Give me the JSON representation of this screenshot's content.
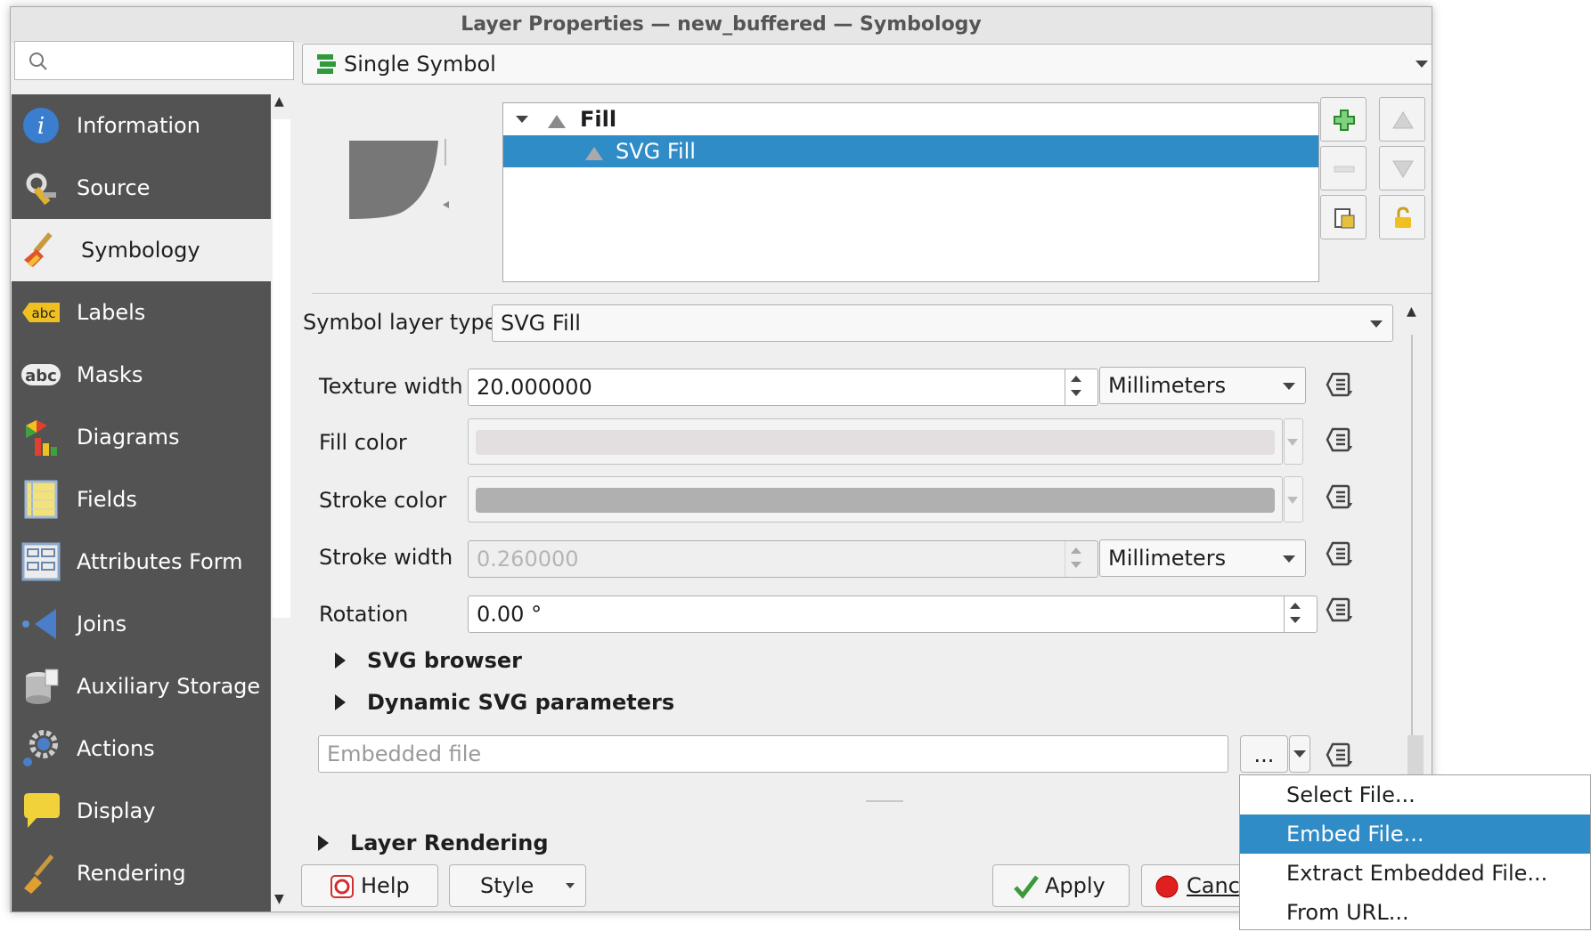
{
  "window": {
    "title": "Layer Properties — new_buffered — Symbology"
  },
  "search": {
    "placeholder": "",
    "icon": "search-icon"
  },
  "sidebar": {
    "items": [
      {
        "label": "Information",
        "icon": "information-icon"
      },
      {
        "label": "Source",
        "icon": "source-icon"
      },
      {
        "label": "Symbology",
        "icon": "symbology-brush-icon",
        "active": true
      },
      {
        "label": "Labels",
        "icon": "labels-abc-icon"
      },
      {
        "label": "Masks",
        "icon": "masks-abc-icon"
      },
      {
        "label": "Diagrams",
        "icon": "diagrams-icon"
      },
      {
        "label": "Fields",
        "icon": "fields-icon"
      },
      {
        "label": "Attributes Form",
        "icon": "attributes-form-icon"
      },
      {
        "label": "Joins",
        "icon": "joins-icon"
      },
      {
        "label": "Auxiliary Storage",
        "icon": "auxiliary-storage-icon"
      },
      {
        "label": "Actions",
        "icon": "actions-gear-icon"
      },
      {
        "label": "Display",
        "icon": "display-speech-icon"
      },
      {
        "label": "Rendering",
        "icon": "rendering-brush-icon"
      }
    ]
  },
  "renderer": {
    "label": "Single Symbol"
  },
  "symbol_tree": {
    "root": "Fill",
    "child": "SVG Fill"
  },
  "symbol_layer_type": {
    "label": "Symbol layer type",
    "value": "SVG Fill"
  },
  "properties": {
    "texture_width": {
      "label": "Texture width",
      "value": "20.000000",
      "unit": "Millimeters"
    },
    "fill_color": {
      "label": "Fill color",
      "swatch": "#e3dfe0"
    },
    "stroke_color": {
      "label": "Stroke color",
      "swatch": "#b0b0b0"
    },
    "stroke_width": {
      "label": "Stroke width",
      "value": "0.260000",
      "unit": "Millimeters"
    },
    "rotation": {
      "label": "Rotation",
      "value": "0.00 °"
    }
  },
  "sections": {
    "svg_browser": "SVG browser",
    "dynamic_svg": "Dynamic SVG parameters",
    "layer_rendering": "Layer Rendering"
  },
  "file_field": {
    "placeholder": "Embedded file",
    "browse_label": "..."
  },
  "buttons": {
    "help": "Help",
    "style": "Style",
    "apply": "Apply",
    "cancel": "Canc"
  },
  "context_menu": {
    "items": [
      "Select File...",
      "Embed File...",
      "Extract Embedded File...",
      "From URL..."
    ],
    "selected_index": 1
  },
  "colors": {
    "selection": "#308cc6",
    "sidebar_bg": "#535353"
  }
}
